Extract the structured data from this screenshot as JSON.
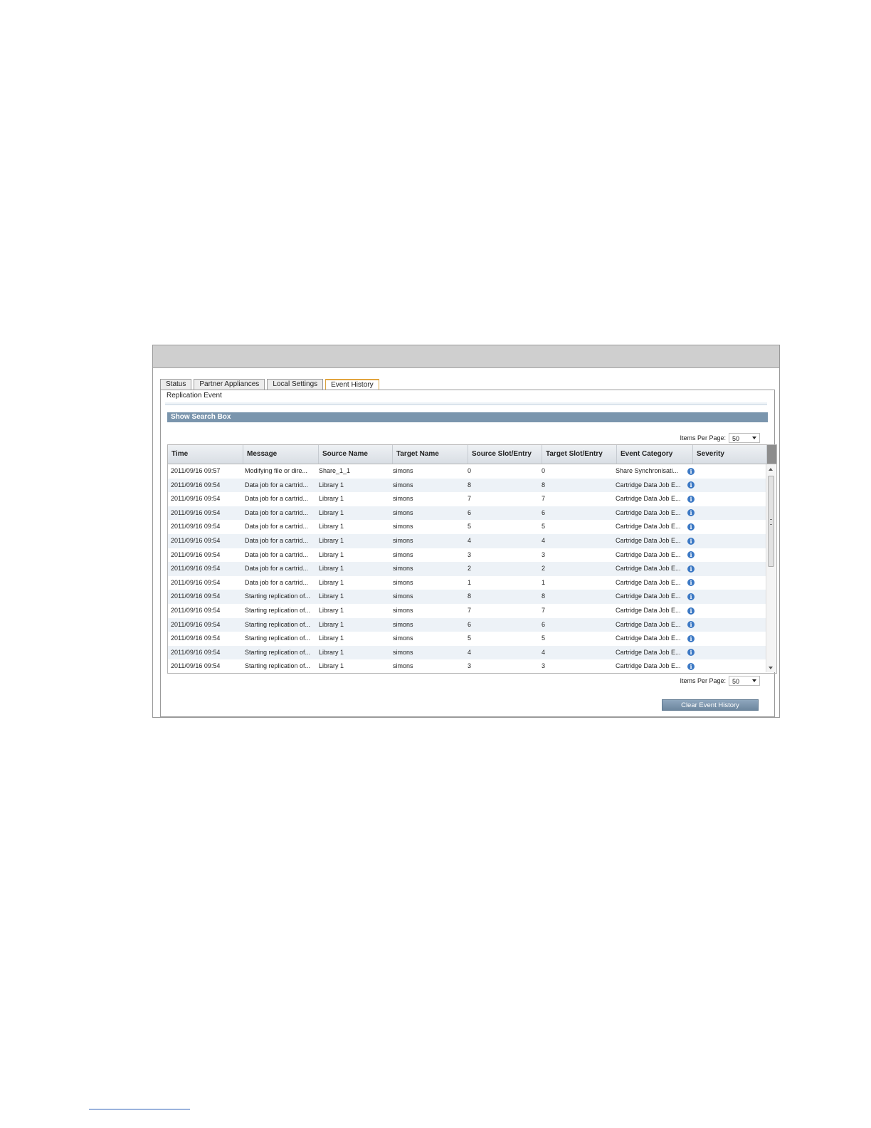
{
  "tabs": [
    {
      "label": "Status"
    },
    {
      "label": "Partner Appliances"
    },
    {
      "label": "Local Settings"
    },
    {
      "label": "Event History",
      "active": true
    }
  ],
  "panel": {
    "subtitle": "Replication Event",
    "search_bar_label": "Show Search Box",
    "items_per_page_label": "Items Per Page:",
    "items_per_page_value": "50",
    "clear_button_label": "Clear Event History"
  },
  "grid": {
    "columns": [
      "Time",
      "Message",
      "Source Name",
      "Target Name",
      "Source Slot/Entry",
      "Target Slot/Entry",
      "Event Category",
      "Severity"
    ],
    "rows": [
      {
        "time": "2011/09/16 09:57",
        "message": "Modifying file or dire...",
        "source": "Share_1_1",
        "target": "simons",
        "src_slot": "0",
        "tgt_slot": "0",
        "category": "Share Synchronisati...",
        "severity": "info"
      },
      {
        "time": "2011/09/16 09:54",
        "message": "Data job for a cartrid...",
        "source": "Library 1",
        "target": "simons",
        "src_slot": "8",
        "tgt_slot": "8",
        "category": "Cartridge Data Job E...",
        "severity": "info"
      },
      {
        "time": "2011/09/16 09:54",
        "message": "Data job for a cartrid...",
        "source": "Library 1",
        "target": "simons",
        "src_slot": "7",
        "tgt_slot": "7",
        "category": "Cartridge Data Job E...",
        "severity": "info"
      },
      {
        "time": "2011/09/16 09:54",
        "message": "Data job for a cartrid...",
        "source": "Library 1",
        "target": "simons",
        "src_slot": "6",
        "tgt_slot": "6",
        "category": "Cartridge Data Job E...",
        "severity": "info"
      },
      {
        "time": "2011/09/16 09:54",
        "message": "Data job for a cartrid...",
        "source": "Library 1",
        "target": "simons",
        "src_slot": "5",
        "tgt_slot": "5",
        "category": "Cartridge Data Job E...",
        "severity": "info"
      },
      {
        "time": "2011/09/16 09:54",
        "message": "Data job for a cartrid...",
        "source": "Library 1",
        "target": "simons",
        "src_slot": "4",
        "tgt_slot": "4",
        "category": "Cartridge Data Job E...",
        "severity": "info"
      },
      {
        "time": "2011/09/16 09:54",
        "message": "Data job for a cartrid...",
        "source": "Library 1",
        "target": "simons",
        "src_slot": "3",
        "tgt_slot": "3",
        "category": "Cartridge Data Job E...",
        "severity": "info"
      },
      {
        "time": "2011/09/16 09:54",
        "message": "Data job for a cartrid...",
        "source": "Library 1",
        "target": "simons",
        "src_slot": "2",
        "tgt_slot": "2",
        "category": "Cartridge Data Job E...",
        "severity": "info"
      },
      {
        "time": "2011/09/16 09:54",
        "message": "Data job for a cartrid...",
        "source": "Library 1",
        "target": "simons",
        "src_slot": "1",
        "tgt_slot": "1",
        "category": "Cartridge Data Job E...",
        "severity": "info"
      },
      {
        "time": "2011/09/16 09:54",
        "message": "Starting replication of...",
        "source": "Library 1",
        "target": "simons",
        "src_slot": "8",
        "tgt_slot": "8",
        "category": "Cartridge Data Job E...",
        "severity": "info"
      },
      {
        "time": "2011/09/16 09:54",
        "message": "Starting replication of...",
        "source": "Library 1",
        "target": "simons",
        "src_slot": "7",
        "tgt_slot": "7",
        "category": "Cartridge Data Job E...",
        "severity": "info"
      },
      {
        "time": "2011/09/16 09:54",
        "message": "Starting replication of...",
        "source": "Library 1",
        "target": "simons",
        "src_slot": "6",
        "tgt_slot": "6",
        "category": "Cartridge Data Job E...",
        "severity": "info"
      },
      {
        "time": "2011/09/16 09:54",
        "message": "Starting replication of...",
        "source": "Library 1",
        "target": "simons",
        "src_slot": "5",
        "tgt_slot": "5",
        "category": "Cartridge Data Job E...",
        "severity": "info"
      },
      {
        "time": "2011/09/16 09:54",
        "message": "Starting replication of...",
        "source": "Library 1",
        "target": "simons",
        "src_slot": "4",
        "tgt_slot": "4",
        "category": "Cartridge Data Job E...",
        "severity": "info"
      },
      {
        "time": "2011/09/16 09:54",
        "message": "Starting replication of...",
        "source": "Library 1",
        "target": "simons",
        "src_slot": "3",
        "tgt_slot": "3",
        "category": "Cartridge Data Job E...",
        "severity": "info"
      }
    ]
  },
  "icons": {
    "severity_info": "info-icon",
    "dropdown": "chevron-down-icon"
  },
  "colors": {
    "header_bar": "#cfcfcf",
    "search_bar": "#7a95ad",
    "active_tab_accent": "#e2a43e",
    "info_icon": "#3b78c4"
  }
}
